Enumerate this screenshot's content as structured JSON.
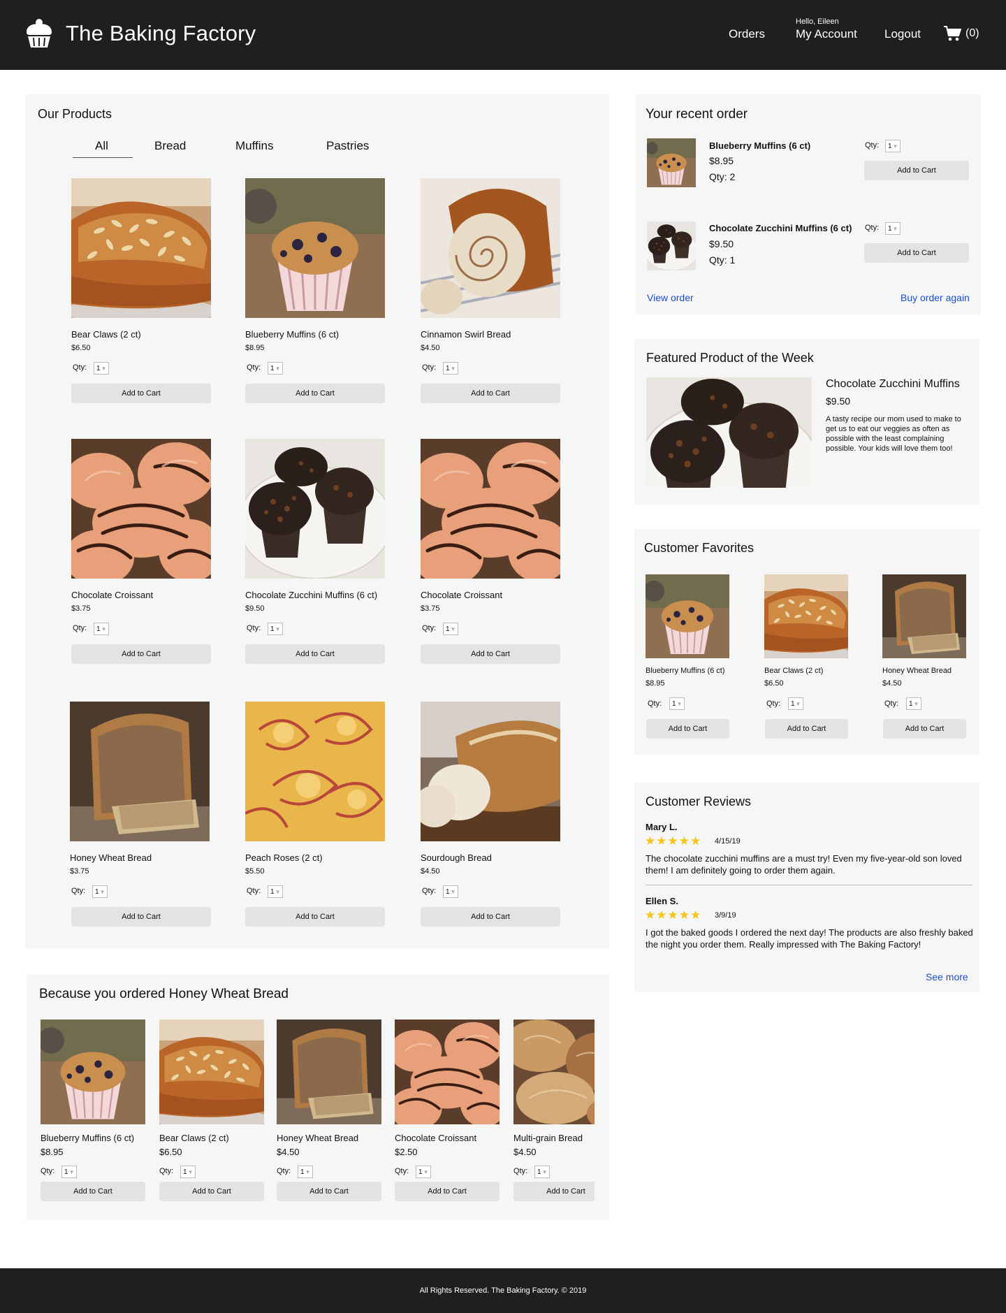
{
  "header": {
    "brand": "The Baking Factory",
    "nav_orders": "Orders",
    "greeting": "Hello, Eileen",
    "nav_account": "My Account",
    "nav_logout": "Logout",
    "cart_count": "(0)"
  },
  "products": {
    "title": "Our Products",
    "tabs": [
      "All",
      "Bread",
      "Muffins",
      "Pastries"
    ],
    "active_tab": "All",
    "qty_label": "Qty:",
    "add_label": "Add to Cart",
    "items": [
      {
        "name": "Bear Claws (2 ct)",
        "price": "$6.50",
        "qty": "1"
      },
      {
        "name": "Blueberry Muffins (6 ct)",
        "price": "$8.95",
        "qty": "1"
      },
      {
        "name": "Cinnamon Swirl Bread",
        "price": "$4.50",
        "qty": "1"
      },
      {
        "name": "Chocolate Croissant",
        "price": "$3.75",
        "qty": "1"
      },
      {
        "name": "Chocolate Zucchini Muffins (6 ct)",
        "price": "$9.50",
        "qty": "1"
      },
      {
        "name": "Chocolate Croissant",
        "price": "$3.75",
        "qty": "1"
      },
      {
        "name": "Honey Wheat Bread",
        "price": "$3.75",
        "qty": "1"
      },
      {
        "name": "Peach Roses (2 ct)",
        "price": "$5.50",
        "qty": "1"
      },
      {
        "name": "Sourdough Bread",
        "price": "$4.50",
        "qty": "1"
      }
    ]
  },
  "because": {
    "title": "Because you ordered Honey Wheat Bread",
    "items": [
      {
        "name": "Blueberry Muffins (6 ct)",
        "price": "$8.95",
        "qty": "1"
      },
      {
        "name": "Bear Claws (2 ct)",
        "price": "$6.50",
        "qty": "1"
      },
      {
        "name": "Honey Wheat Bread",
        "price": "$4.50",
        "qty": "1"
      },
      {
        "name": "Chocolate Croissant",
        "price": "$2.50",
        "qty": "1"
      },
      {
        "name": "Multi-grain Bread",
        "price": "$4.50",
        "qty": "1"
      }
    ]
  },
  "recent_order": {
    "title": "Your recent order",
    "items": [
      {
        "name": "Blueberry Muffins (6 ct)",
        "price": "$8.95",
        "count": "Qty: 2",
        "qty": "1"
      },
      {
        "name": "Chocolate Zucchini Muffins (6 ct)",
        "price": "$9.50",
        "count": "Qty: 1",
        "qty": "1"
      }
    ],
    "view_order": "View order",
    "buy_again": "Buy order again"
  },
  "featured": {
    "title": "Featured Product of the Week",
    "name": "Chocolate Zucchini Muffins",
    "price": "$9.50",
    "description": "A tasty recipe our mom used to make to get us to eat our veggies as often as possible with the least complaining possible. Your kids will love them too!"
  },
  "favorites": {
    "title": "Customer Favorites",
    "items": [
      {
        "name": "Blueberry Muffins (6 ct)",
        "price": "$8.95",
        "qty": "1"
      },
      {
        "name": "Bear Claws (2 ct)",
        "price": "$6.50",
        "qty": "1"
      },
      {
        "name": "Honey Wheat Bread",
        "price": "$4.50",
        "qty": "1"
      }
    ]
  },
  "reviews": {
    "title": "Customer Reviews",
    "items": [
      {
        "author": "Mary L.",
        "rating": 5,
        "stars": "★★★★★",
        "date": "4/15/19",
        "text": "The chocolate zucchini muffins are a must try! Even my five-year-old son loved them! I am definitely going to order them again."
      },
      {
        "author": "Ellen S.",
        "rating": 5,
        "stars": "★★★★★",
        "date": "3/9/19",
        "text": "I got the baked goods I ordered the next day! The products are also freshly baked the night you order them. Really impressed with The Baking Factory!"
      }
    ],
    "see_more": "See more"
  },
  "footer": {
    "text": "All Rights Reserved. The Baking Factory. © 2019"
  },
  "colors": {
    "header_bg": "#1f1f1f",
    "panel_bg": "#f6f6f6",
    "button_bg": "#e3e3e3",
    "link": "#1a4fd0",
    "star": "#f5c518"
  }
}
